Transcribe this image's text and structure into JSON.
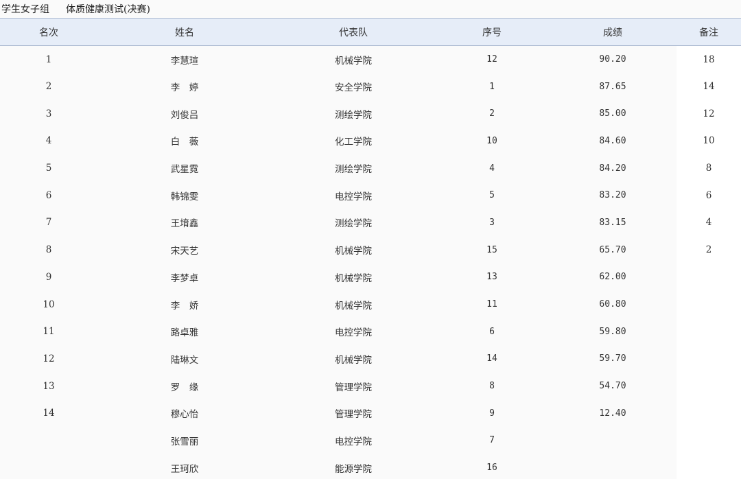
{
  "header": {
    "group": "学生女子组",
    "event": "体质健康测试(决赛)"
  },
  "columns": [
    "名次",
    "姓名",
    "代表队",
    "序号",
    "成绩",
    "备注"
  ],
  "rows": [
    {
      "rank": "1",
      "name": "李慧瑄",
      "team": "机械学院",
      "seq": "12",
      "score": "90.20",
      "note": "18"
    },
    {
      "rank": "2",
      "name": "李　婷",
      "team": "安全学院",
      "seq": "1",
      "score": "87.65",
      "note": "14"
    },
    {
      "rank": "3",
      "name": "刘俊吕",
      "team": "测绘学院",
      "seq": "2",
      "score": "85.00",
      "note": "12"
    },
    {
      "rank": "4",
      "name": "白　薇",
      "team": "化工学院",
      "seq": "10",
      "score": "84.60",
      "note": "10"
    },
    {
      "rank": "5",
      "name": "武星霓",
      "team": "测绘学院",
      "seq": "4",
      "score": "84.20",
      "note": "8"
    },
    {
      "rank": "6",
      "name": "韩锦雯",
      "team": "电控学院",
      "seq": "5",
      "score": "83.20",
      "note": "6"
    },
    {
      "rank": "7",
      "name": "王堉鑫",
      "team": "测绘学院",
      "seq": "3",
      "score": "83.15",
      "note": "4"
    },
    {
      "rank": "8",
      "name": "宋天艺",
      "team": "机械学院",
      "seq": "15",
      "score": "65.70",
      "note": "2"
    },
    {
      "rank": "9",
      "name": "李梦卓",
      "team": "机械学院",
      "seq": "13",
      "score": "62.00",
      "note": ""
    },
    {
      "rank": "10",
      "name": "李　娇",
      "team": "机械学院",
      "seq": "11",
      "score": "60.80",
      "note": ""
    },
    {
      "rank": "11",
      "name": "路卓雅",
      "team": "电控学院",
      "seq": "6",
      "score": "59.80",
      "note": ""
    },
    {
      "rank": "12",
      "name": "陆琳文",
      "team": "机械学院",
      "seq": "14",
      "score": "59.70",
      "note": ""
    },
    {
      "rank": "13",
      "name": "罗　缘",
      "team": "管理学院",
      "seq": "8",
      "score": "54.70",
      "note": ""
    },
    {
      "rank": "14",
      "name": "穆心怡",
      "team": "管理学院",
      "seq": "9",
      "score": "12.40",
      "note": ""
    },
    {
      "rank": "",
      "name": "张雪丽",
      "team": "电控学院",
      "seq": "7",
      "score": "",
      "note": ""
    },
    {
      "rank": "",
      "name": "王珂欣",
      "team": "能源学院",
      "seq": "16",
      "score": "",
      "note": ""
    }
  ]
}
